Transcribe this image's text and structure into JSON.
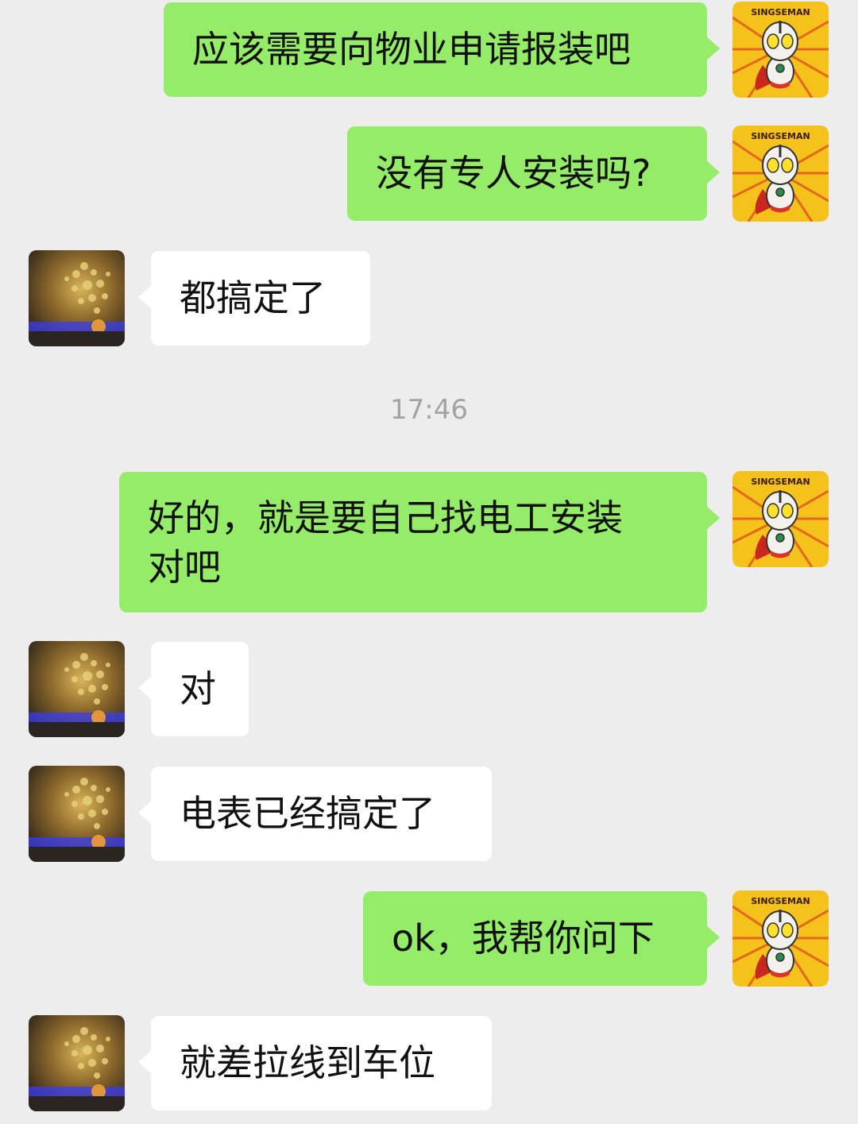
{
  "chat": {
    "timestamp": "17:46",
    "messages": [
      {
        "direction": "sent",
        "text": "应该需要向物业申请报装吧"
      },
      {
        "direction": "sent",
        "text": "没有专人安装吗?"
      },
      {
        "direction": "received",
        "text": "都搞定了"
      },
      {
        "direction": "sent",
        "text": "好的，就是要自己找电工安装\n对吧"
      },
      {
        "direction": "received",
        "text": "对"
      },
      {
        "direction": "received",
        "text": "电表已经搞定了"
      },
      {
        "direction": "sent",
        "text": "ok，我帮你问下"
      },
      {
        "direction": "received",
        "text": "就差拉线到车位"
      }
    ]
  },
  "avatars": {
    "self": {
      "label": "SINGSEMAN",
      "icon": "ultraman-cartoon-avatar"
    },
    "contact": {
      "icon": "golden-tree-photo-avatar"
    }
  },
  "colors": {
    "background": "#ededed",
    "sent_bubble": "#95ec69",
    "received_bubble": "#ffffff",
    "timestamp": "#a3a3a3"
  }
}
